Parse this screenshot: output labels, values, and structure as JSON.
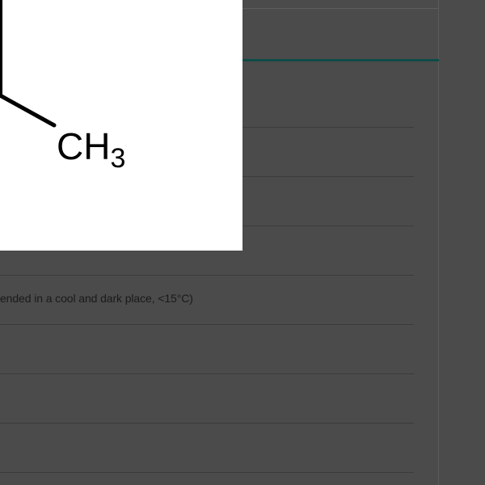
{
  "structure": {
    "group_main": "CH",
    "group_subscript": "3"
  },
  "spec_rows": [
    {
      "value": ""
    },
    {
      "value": ""
    },
    {
      "value": ""
    },
    {
      "value": ""
    },
    {
      "value": "ended in a cool and dark place, <15°C)"
    },
    {
      "value": ""
    },
    {
      "value": ""
    },
    {
      "value": ""
    }
  ],
  "colors": {
    "background": "#4b4b4b",
    "accent": "#0f4b48",
    "image_background": "#ffffff"
  }
}
